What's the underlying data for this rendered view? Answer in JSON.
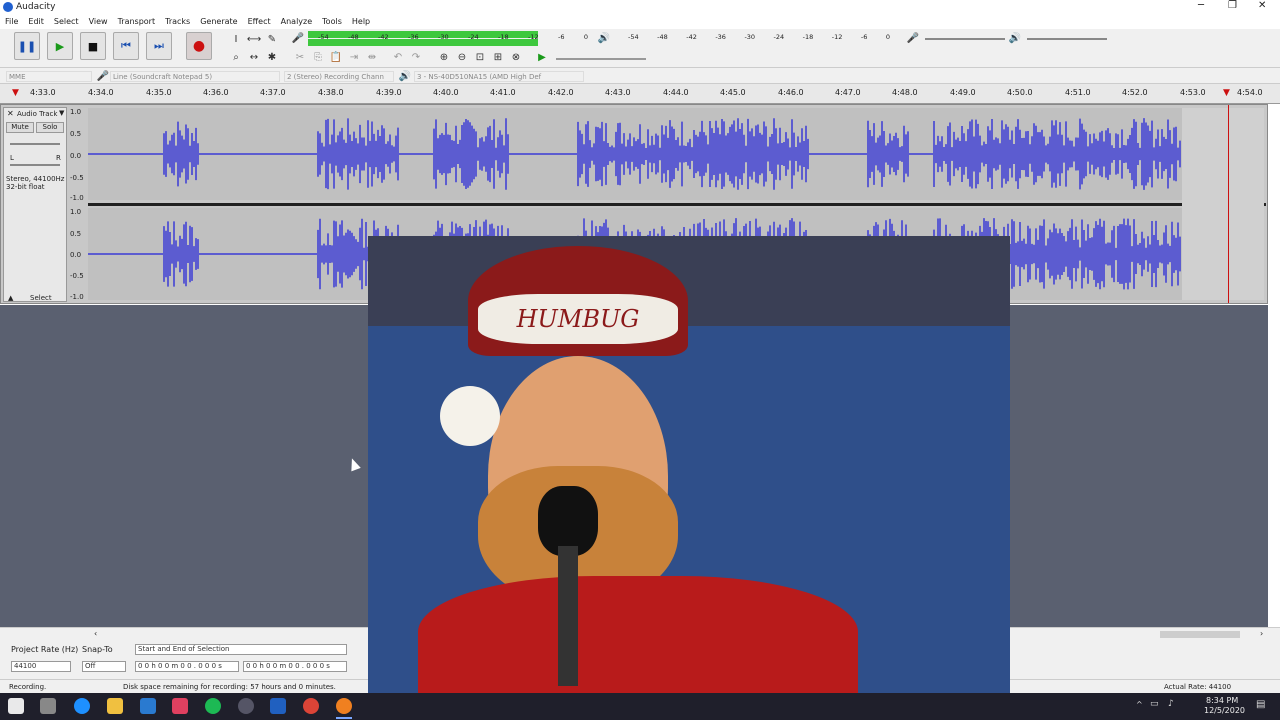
{
  "window": {
    "title": "Audacity"
  },
  "menu": [
    "File",
    "Edit",
    "Select",
    "View",
    "Transport",
    "Tracks",
    "Generate",
    "Effect",
    "Analyze",
    "Tools",
    "Help"
  ],
  "meters": {
    "record_ticks": [
      "-54",
      "-48",
      "-42",
      "-36",
      "-30",
      "-24",
      "-18",
      "-12",
      "-6",
      "0"
    ],
    "play_ticks": [
      "-54",
      "-48",
      "-42",
      "-36",
      "-30",
      "-24",
      "-18",
      "-12",
      "-6",
      "0"
    ]
  },
  "devices": {
    "host": "MME",
    "input": "Line (Soundcraft Notepad 5)",
    "channels": "2 (Stereo) Recording Chann",
    "output": "3 - NS-40D510NA15 (AMD High Def"
  },
  "ruler": {
    "ticks": [
      "4:33.0",
      "4:34.0",
      "4:35.0",
      "4:36.0",
      "4:37.0",
      "4:38.0",
      "4:39.0",
      "4:40.0",
      "4:41.0",
      "4:42.0",
      "4:43.0",
      "4:44.0",
      "4:45.0",
      "4:46.0",
      "4:47.0",
      "4:48.0",
      "4:49.0",
      "4:50.0",
      "4:51.0",
      "4:52.0",
      "4:53.0",
      "4:54.0"
    ]
  },
  "track": {
    "name": "Audio Track",
    "mute": "Mute",
    "solo": "Solo",
    "gain_left": "L",
    "gain_right": "R",
    "info_line1": "Stereo, 44100Hz",
    "info_line2": "32-bit float",
    "select": "Select",
    "scale": [
      "1.0",
      "0.5",
      "0.0",
      "-0.5",
      "-1.0"
    ]
  },
  "overlay": {
    "hat_text": "HUMBUG"
  },
  "selection": {
    "project_rate_label": "Project Rate (Hz)",
    "project_rate_value": "44100",
    "snap_label": "Snap-To",
    "snap_value": "Off",
    "mode": "Start and End of Selection",
    "start": "0 0 h 0 0 m 0 0 . 0 0 0 s",
    "end": "0 0 h 0 0 m 0 0 . 0 0 0 s"
  },
  "status": {
    "state": "Recording.",
    "disk": "Disk space remaining for recording: 57 hours and 0 minutes.",
    "rate": "Actual Rate: 44100"
  },
  "clock": {
    "time": "8:34 PM",
    "date": "12/5/2020"
  },
  "colors": {
    "accent": "#3b3bd6",
    "meter_green": "#3ec83e",
    "record_red": "#cc1010"
  }
}
